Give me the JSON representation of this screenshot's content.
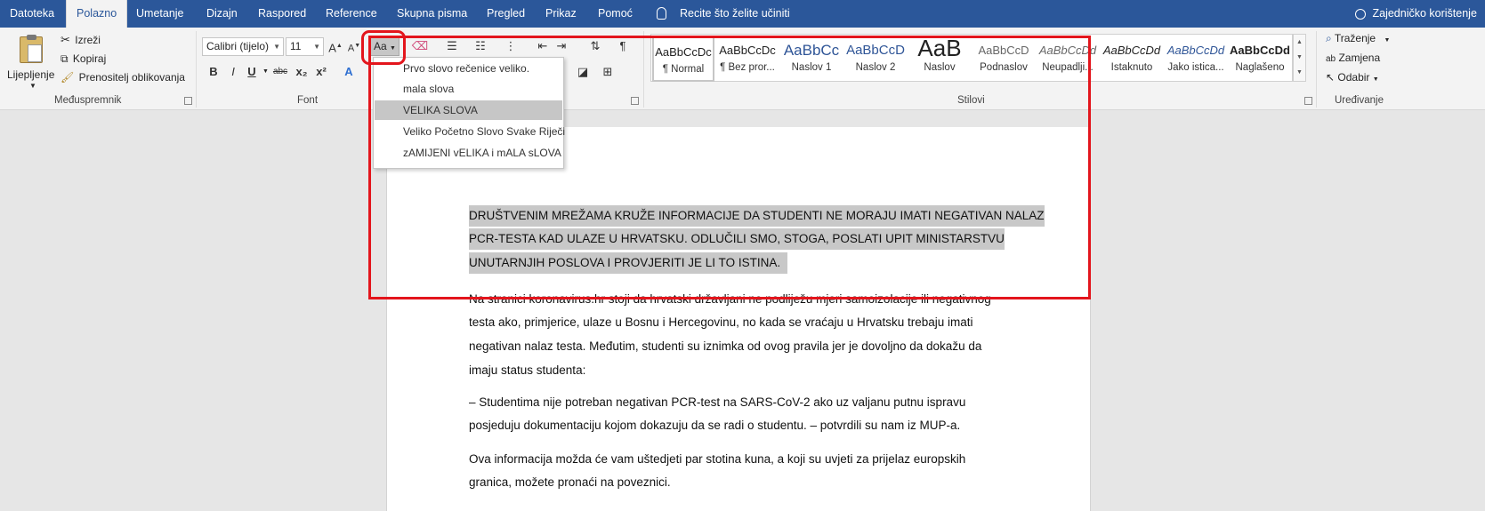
{
  "menu": {
    "tabs": [
      "Datoteka",
      "Polazno",
      "Umetanje",
      "Dizajn",
      "Raspored",
      "Reference",
      "Skupna pisma",
      "Pregled",
      "Prikaz",
      "Pomoć"
    ],
    "active_tab": "Polazno",
    "tell_me": "Recite što želite učiniti",
    "share": "Zajedničko korištenje"
  },
  "clipboard": {
    "paste": "Lijepljenje",
    "cut": "Izreži",
    "copy": "Kopiraj",
    "format_painter": "Prenositelj oblikovanja",
    "label": "Međuspremnik"
  },
  "font": {
    "name": "Calibri (tijelo)",
    "size": "11",
    "change_case": "Aa",
    "label": "Font",
    "buttons": [
      "B",
      "I",
      "U",
      "abc",
      "x₂",
      "x²"
    ]
  },
  "styles": {
    "label": "Stilovi",
    "items": [
      {
        "preview": "AaBbCcDc",
        "name": "¶ Normal"
      },
      {
        "preview": "AaBbCcDc",
        "name": "¶ Bez pror..."
      },
      {
        "preview": "AaBbCc",
        "name": "Naslov 1"
      },
      {
        "preview": "AaBbCcD",
        "name": "Naslov 2"
      },
      {
        "preview": "AaB",
        "name": "Naslov"
      },
      {
        "preview": "AaBbCcD",
        "name": "Podnaslov"
      },
      {
        "preview": "AaBbCcDd",
        "name": "Neupadlji..."
      },
      {
        "preview": "AaBbCcDd",
        "name": "Istaknuto"
      },
      {
        "preview": "AaBbCcDd",
        "name": "Jako istica..."
      },
      {
        "preview": "AaBbCcDd",
        "name": "Naglašeno"
      }
    ]
  },
  "editing": {
    "find": "Traženje",
    "replace": "Zamjena",
    "select": "Odabir",
    "label": "Uređivanje"
  },
  "change_case_menu": [
    "Prvo slovo rečenice veliko.",
    "mala slova",
    "VELIKA SLOVA",
    "Veliko Početno Slovo Svake Riječi",
    "zAMIJENI vELIKA i mALA sLOVA"
  ],
  "document": {
    "selected_lines": [
      "DRUŠTVENIM MREŽAMA KRUŽE INFORMACIJE DA STUDENTI NE MORAJU IMATI NEGATIVAN NALAZ",
      "PCR-TESTA KAD ULAZE U HRVATSKU. ODLUČILI SMO, STOGA, POSLATI UPIT MINISTARSTVU",
      "UNUTARNJIH POSLOVA I PROVJERITI JE LI TO ISTINA."
    ],
    "p2_lines": [
      "Na stranici koronavirus.hr stoji da hrvatski državljani ne podliježu mjeri samoizolacije ili negativnog",
      "testa ako, primjerice, ulaze u Bosnu i Hercegovinu, no kada se vraćaju u Hrvatsku trebaju imati",
      "negativan nalaz testa. Međutim, studenti su iznimka od ovog pravila jer je dovoljno da dokažu da",
      "imaju status studenta:"
    ],
    "p3_lines": [
      "– Studentima nije potreban negativan PCR-test na SARS-CoV-2 ako uz valjanu putnu ispravu",
      "posjeduju dokumentaciju kojom dokazuju da se radi o studentu. – potvrdili su nam iz MUP-a."
    ],
    "p4_lines": [
      "Ova informacija možda će vam uštedjeti par stotina kuna, a koji su uvjeti za prijelaz europskih",
      "granica, možete pronaći na poveznici."
    ]
  }
}
